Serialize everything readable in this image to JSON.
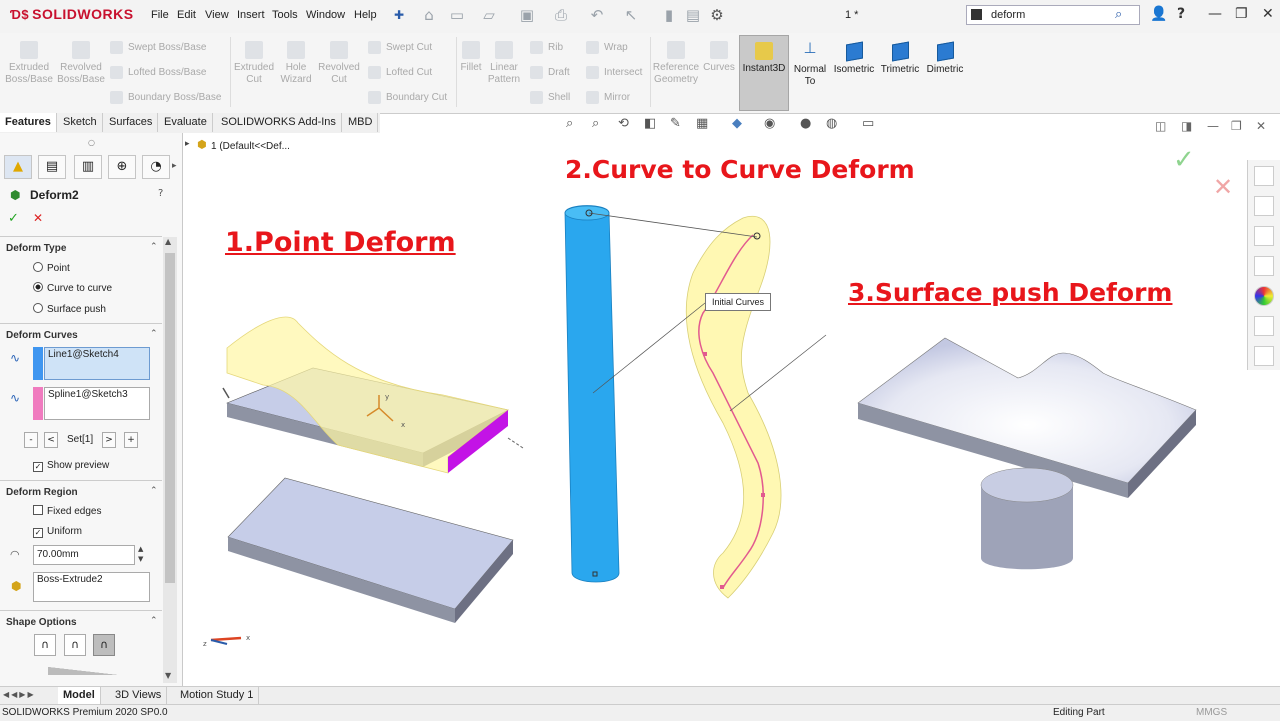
{
  "app": {
    "logo": "SOLIDWORKS",
    "doc_title": "1 *"
  },
  "menu": [
    "File",
    "Edit",
    "View",
    "Insert",
    "Tools",
    "Window",
    "Help"
  ],
  "search": {
    "value": "deform"
  },
  "ribbon": {
    "extruded_boss": "Extruded Boss/Base",
    "revolved_boss": "Revolved Boss/Base",
    "swept_boss": "Swept Boss/Base",
    "lofted_boss": "Lofted Boss/Base",
    "boundary_boss": "Boundary Boss/Base",
    "extruded_cut": "Extruded Cut",
    "hole_wizard": "Hole Wizard",
    "revolved_cut": "Revolved Cut",
    "swept_cut": "Swept Cut",
    "lofted_cut": "Lofted Cut",
    "boundary_cut": "Boundary Cut",
    "fillet": "Fillet",
    "linear_pattern": "Linear Pattern",
    "rib": "Rib",
    "draft": "Draft",
    "shell": "Shell",
    "wrap": "Wrap",
    "intersect": "Intersect",
    "mirror": "Mirror",
    "reference_geometry": "Reference Geometry",
    "curves": "Curves",
    "instant3d": "Instant3D",
    "normal_to": "Normal To",
    "isometric": "Isometric",
    "trimetric": "Trimetric",
    "dimetric": "Dimetric"
  },
  "tabs": [
    "Features",
    "Sketch",
    "Surfaces",
    "Evaluate",
    "SOLIDWORKS Add-Ins",
    "MBD"
  ],
  "tree": {
    "root": "1  (Default<<Def..."
  },
  "panel": {
    "title": "Deform2",
    "deform_type": {
      "heading": "Deform Type",
      "options": [
        "Point",
        "Curve to curve",
        "Surface push"
      ],
      "selected": "Curve to curve"
    },
    "deform_curves": {
      "heading": "Deform Curves",
      "initial": "Line1@Sketch4",
      "target": "Spline1@Sketch3",
      "set_label": "Set[1]",
      "show_preview": "Show preview"
    },
    "deform_region": {
      "heading": "Deform Region",
      "fixed_edges": "Fixed edges",
      "uniform": "Uniform",
      "radius": "70.00mm",
      "body": "Boss-Extrude2"
    },
    "shape_options": {
      "heading": "Shape Options"
    }
  },
  "viewport": {
    "label1": "1.Point Deform",
    "label2": "2.Curve to Curve Deform",
    "label3": "3.Surface push Deform",
    "callout": "Initial Curves",
    "triad_x": "x",
    "triad_y": "y",
    "axis_z": "z"
  },
  "bottom_tabs": [
    "Model",
    "3D Views",
    "Motion Study 1"
  ],
  "status": {
    "left": "SOLIDWORKS Premium 2020 SP0.0",
    "mid": "Editing Part",
    "units": "MMGS"
  },
  "colors": {
    "accent_red": "#e8161b",
    "cyan_body": "#2aa7ee",
    "yellow_body": "#fff7a6",
    "magenta_face": "#c313e6"
  }
}
